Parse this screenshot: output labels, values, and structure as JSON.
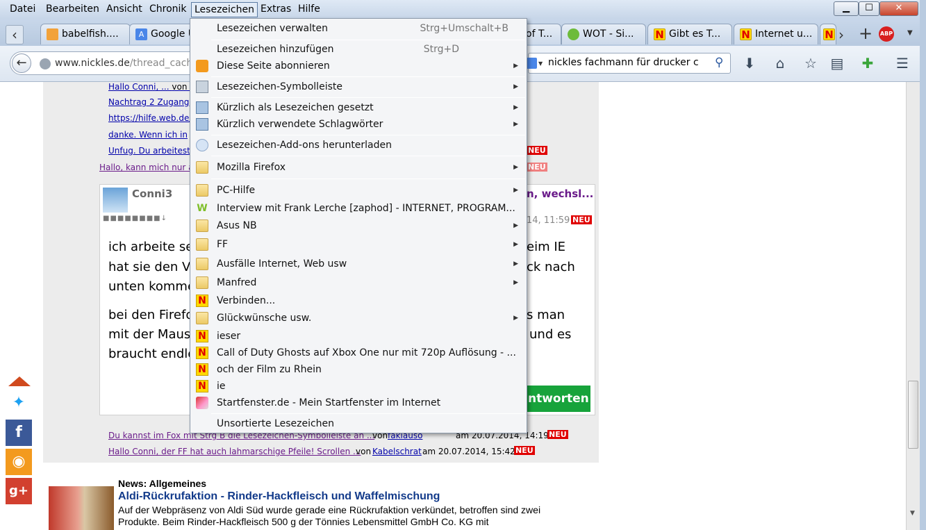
{
  "menubar": {
    "items": [
      "Datei",
      "Bearbeiten",
      "Ansicht",
      "Chronik",
      "Lesezeichen",
      "Extras",
      "Hilfe"
    ]
  },
  "window": {
    "minimize": "▁",
    "maximize": "☐",
    "close": "✕"
  },
  "tabs": [
    {
      "label": "babelfish....",
      "icon": "chat-icon"
    },
    {
      "label": "Google Ü",
      "icon": "google-translate-icon"
    },
    {
      "label": "of T...",
      "icon": "page-icon"
    },
    {
      "label": "WOT - Si...",
      "icon": "wot-icon"
    },
    {
      "label": "Gibt es T...",
      "icon": "nickles-icon"
    },
    {
      "label": "Internet u...",
      "icon": "nickles-icon"
    },
    {
      "label": "N",
      "icon": "nickles-icon"
    }
  ],
  "tabbar": {
    "back": "‹",
    "forward": "›",
    "new_tab": "+",
    "abp": "ABP"
  },
  "url": {
    "host": "www.nickles.de",
    "path": "/thread_cache"
  },
  "search": {
    "value": "nickles fachmann für drucker c"
  },
  "post": {
    "links": [
      {
        "text": "Hallo Conni, ...",
        "suffix": "von K"
      },
      {
        "text": "Nachtrag 2 Zugang"
      },
      {
        "text": "https://hilfe.web.de/e"
      },
      {
        "text": "danke. Wenn ich in"
      },
      {
        "text": "Unfug. Du arbeitest"
      },
      {
        "text": "Hallo, kann mich nur a"
      }
    ],
    "author": "Conni3",
    "title_tail": "n, wechsl...",
    "date": "14, 11:59",
    "neu": "NEU",
    "body_left": [
      "ich arbeite se",
      "hat sie den Vo",
      "unten komme",
      "bei den Firefo",
      "mit der Maus",
      "braucht  endlo"
    ],
    "body_right": [
      "eim IE",
      "ck nach",
      "s man",
      "und  es"
    ],
    "reply": "ntworten",
    "foot": [
      {
        "text": "Du kannst im Fox mit Strg B die Lesezeichen-Symbolleiste an ...",
        "by": "von",
        "user": "fakiauso",
        "date": "am 20.07.2014, 14:19"
      },
      {
        "text": "Hallo Conni, der FF hat auch lahmarschige Pfeile! Scrollen ...",
        "by": "von",
        "user": "Kabelschrat",
        "date": "am 20.07.2014, 15:42"
      }
    ]
  },
  "news": {
    "category": "News: Allgemeines",
    "title": "Aldi-Rückrufaktion - Rinder-Hackfleisch und Waffelmischung",
    "text1": "Auf der Webpräsenz von Aldi Süd wurde gerade eine Rückrufaktion verkündet, betroffen sind zwei",
    "text2": "Produkte. Beim Rinder-Hackfleisch 500 g der Tönnies Lebensmittel GmbH Co. KG mit"
  },
  "menu": {
    "items": [
      {
        "label": "Lesezeichen verwalten",
        "shortcut": "Strg+Umschalt+B"
      },
      {
        "label": "Lesezeichen hinzufügen",
        "shortcut": "Strg+D"
      },
      {
        "label": "Diese Seite abonnieren",
        "sub": "▶"
      },
      {
        "label": "Lesezeichen-Symbolleiste",
        "sub": "▶"
      },
      {
        "label": "Kürzlich als Lesezeichen gesetzt",
        "sub": "▶"
      },
      {
        "label": "Kürzlich verwendete Schlagwörter",
        "sub": "▶"
      },
      {
        "label": "Lesezeichen-Add-ons herunterladen"
      },
      {
        "label": "Mozilla Firefox",
        "sub": "▶"
      },
      {
        "label": "PC-Hilfe",
        "sub": "▶"
      },
      {
        "label": "Interview mit Frank Lerche [zaphod] - INTERNET, PROGRAM..."
      },
      {
        "label": "Asus NB",
        "sub": "▶"
      },
      {
        "label": "FF",
        "sub": "▶"
      },
      {
        "label": "Ausfälle Internet, Web usw",
        "sub": "▶"
      },
      {
        "label": "Manfred",
        "sub": "▶"
      },
      {
        "label": "Verbinden..."
      },
      {
        "label": "Glückwünsche usw.",
        "sub": "▶"
      },
      {
        "label": "ieser"
      },
      {
        "label": "Call of Duty Ghosts auf Xbox One nur mit 720p Auflösung - ..."
      },
      {
        "label": "och der Film zu Rhein"
      },
      {
        "label": "ie"
      },
      {
        "label": "Startfenster.de - Mein Startfenster im Internet"
      },
      {
        "label": "Unsortierte Lesezeichen"
      }
    ]
  }
}
